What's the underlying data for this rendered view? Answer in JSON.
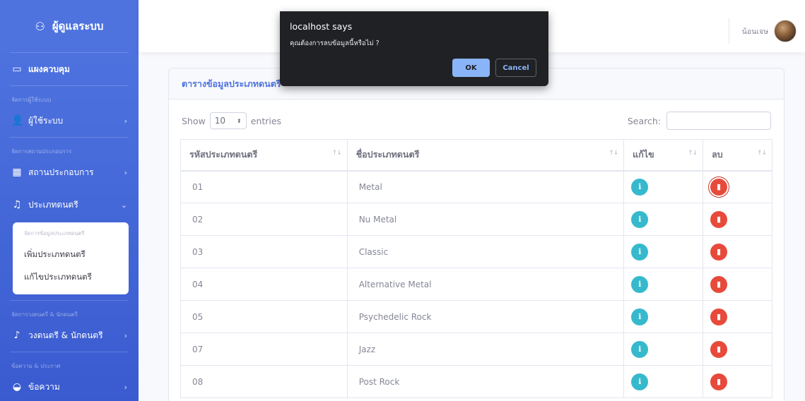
{
  "sidebar": {
    "brand": "ผู้ดูแลระบบ",
    "dashboard": "แผงควบคุม",
    "sections": [
      {
        "heading": "จัดการผู้ใช้ระบบ",
        "item": "ผู้ใช้ระบบ"
      },
      {
        "heading": "จัดการสถานประกอบการ",
        "item": "สถานประกอบการ"
      },
      {
        "heading": "",
        "item": "ประเภทดนตรี"
      },
      {
        "heading": "จัดการวงดนตรี & นักดนตรี",
        "item": "วงดนตรี & นักดนตรี"
      },
      {
        "heading": "ข้อความ & ประกาศ",
        "item": "ข้อความ"
      }
    ],
    "submenu": {
      "heading": "จัดการข้อมูลประเภทดนตรี",
      "items": [
        "เพิ่มประเภทดนตรี",
        "แก้ไขประเภทดนตรี"
      ]
    }
  },
  "topbar": {
    "user_name": "น้อนเจษ"
  },
  "card": {
    "title": "ตารางข้อมูลประเภทดนตรี",
    "show_label": "Show",
    "entries_value": "10",
    "entries_label": "entries",
    "search_label": "Search:"
  },
  "table": {
    "headers": [
      "รหัสประเภทดนตรี",
      "ชื่อประเภทดนตรี",
      "แก้ไข",
      "ลบ"
    ],
    "rows": [
      {
        "id": "01",
        "name": "Metal"
      },
      {
        "id": "02",
        "name": "Nu Metal"
      },
      {
        "id": "03",
        "name": "Classic"
      },
      {
        "id": "04",
        "name": "Alternative Metal"
      },
      {
        "id": "05",
        "name": "Psychedelic Rock"
      },
      {
        "id": "07",
        "name": "Jazz"
      },
      {
        "id": "08",
        "name": "Post Rock"
      }
    ]
  },
  "dialog": {
    "title": "localhost says",
    "message": "คุณต้องการลบข้อมูลนี้หรือไม่ ?",
    "ok": "OK",
    "cancel": "Cancel"
  },
  "colors": {
    "primary": "#4e73df",
    "info": "#36b9cc",
    "danger": "#e74a3b"
  }
}
